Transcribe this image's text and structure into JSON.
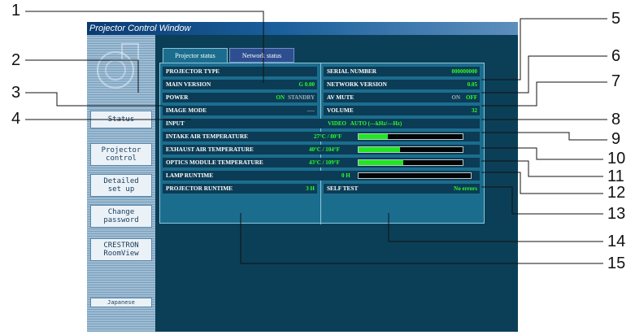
{
  "window_title": "Projector Control Window",
  "sidebar": {
    "items": [
      "Status",
      "Projector\ncontrol",
      "Detailed\nset up",
      "Change\npassword",
      "CRESTRON\nRoomView",
      "Japanese"
    ]
  },
  "tabs": [
    "Projector status",
    "Network status"
  ],
  "left_rows": [
    {
      "label": "PROJECTOR TYPE",
      "value": ""
    },
    {
      "label": "MAIN VERSION",
      "value": "G 0.00"
    },
    {
      "label": "POWER",
      "on": "ON",
      "off": "STANDBY"
    },
    {
      "label": "IMAGE MODE",
      "value": "----"
    }
  ],
  "right_rows": [
    {
      "label": "SERIAL NUMBER",
      "value": "000000000"
    },
    {
      "label": "NETWORK VERSION",
      "value": "0.05"
    },
    {
      "label": "AV MUTE",
      "on": "ON",
      "off": "OFF"
    },
    {
      "label": "VOLUME",
      "value": "32"
    }
  ],
  "input": {
    "label": "INPUT",
    "value": "VIDEO   AUTO (---kHz/---Hz)"
  },
  "temps": [
    {
      "label": "INTAKE AIR TEMPERATURE",
      "value": "27°C / 80°F",
      "level": 0.28
    },
    {
      "label": "EXHAUST AIR TEMPERATURE",
      "value": "40°C / 104°F",
      "level": 0.4
    },
    {
      "label": "OPTICS MODULE TEMPERATURE",
      "value": "43°C / 109°F",
      "level": 0.43
    }
  ],
  "lamp": {
    "label": "LAMP RUNTIME",
    "value": "0 H",
    "level": 0
  },
  "projector_runtime": {
    "label": "PROJECTOR RUNTIME",
    "value": "3 H"
  },
  "self_test": {
    "label": "SELF TEST",
    "value": "No errors"
  },
  "callouts": [
    "1",
    "2",
    "3",
    "4",
    "5",
    "6",
    "7",
    "8",
    "9",
    "10",
    "11",
    "12",
    "13",
    "14",
    "15"
  ],
  "colors": {
    "status_green": "#2aff2a",
    "panel": "#1b6d8e",
    "row_bg": "#0c3c55"
  }
}
